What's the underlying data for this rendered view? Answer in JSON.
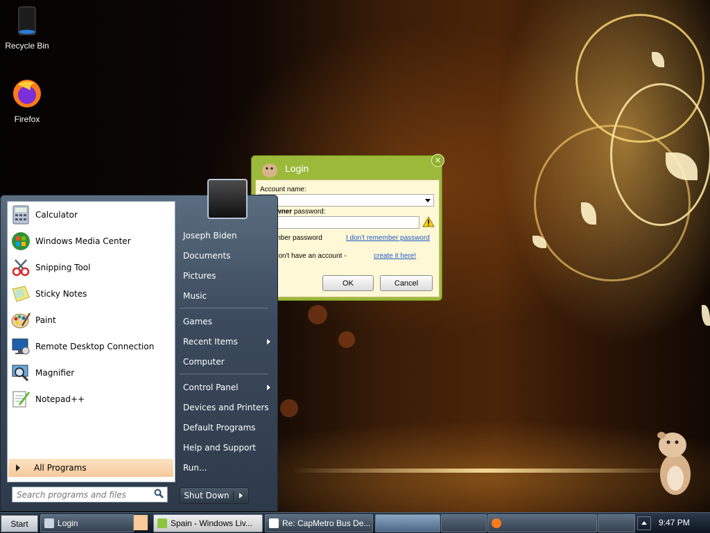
{
  "desktop": {
    "icons": [
      {
        "label": "Recycle Bin",
        "icon": "recycle-bin-icon"
      },
      {
        "label": "Firefox",
        "icon": "firefox-icon"
      }
    ]
  },
  "start_menu": {
    "programs": [
      {
        "label": "Calculator",
        "icon": "calculator-icon"
      },
      {
        "label": "Windows Media Center",
        "icon": "windows-media-center-icon"
      },
      {
        "label": "Snipping Tool",
        "icon": "snipping-tool-icon"
      },
      {
        "label": "Sticky Notes",
        "icon": "sticky-notes-icon"
      },
      {
        "label": "Paint",
        "icon": "paint-icon"
      },
      {
        "label": "Remote Desktop Connection",
        "icon": "remote-desktop-icon"
      },
      {
        "label": "Magnifier",
        "icon": "magnifier-icon"
      },
      {
        "label": "Notepad++",
        "icon": "notepad-plus-plus-icon"
      }
    ],
    "all_programs": "All Programs",
    "search_placeholder": "Search programs and files",
    "right_items": {
      "user": "Joseph Biden",
      "documents": "Documents",
      "pictures": "Pictures",
      "music": "Music",
      "games": "Games",
      "recent_items": "Recent Items",
      "computer": "Computer",
      "control_panel": "Control Panel",
      "devices_printers": "Devices and Printers",
      "default_programs": "Default Programs",
      "help_support": "Help and Support",
      "run": "Run..."
    },
    "shutdown": "Shut Down"
  },
  "login_dialog": {
    "title": "Login",
    "account_name_label": "Account name:",
    "password_label_prefix": "unt ",
    "password_label_bold": "owner",
    "password_label_suffix": " password:",
    "remember_label": "emember password",
    "forgot_link": "I don't remember password",
    "no_account_text": "you don't have an account -",
    "create_link": "create it here!",
    "ok": "OK",
    "cancel": "Cancel"
  },
  "taskbar": {
    "start": "Start",
    "buttons": [
      "Login",
      "Spain - Windows Liv...",
      "Re: CapMetro Bus De..."
    ],
    "clock": "9:47 PM"
  },
  "colors": {
    "dialog_green": "#9cba3a",
    "link_blue": "#1b59c9",
    "all_programs_highlight": "#f6c99a"
  }
}
